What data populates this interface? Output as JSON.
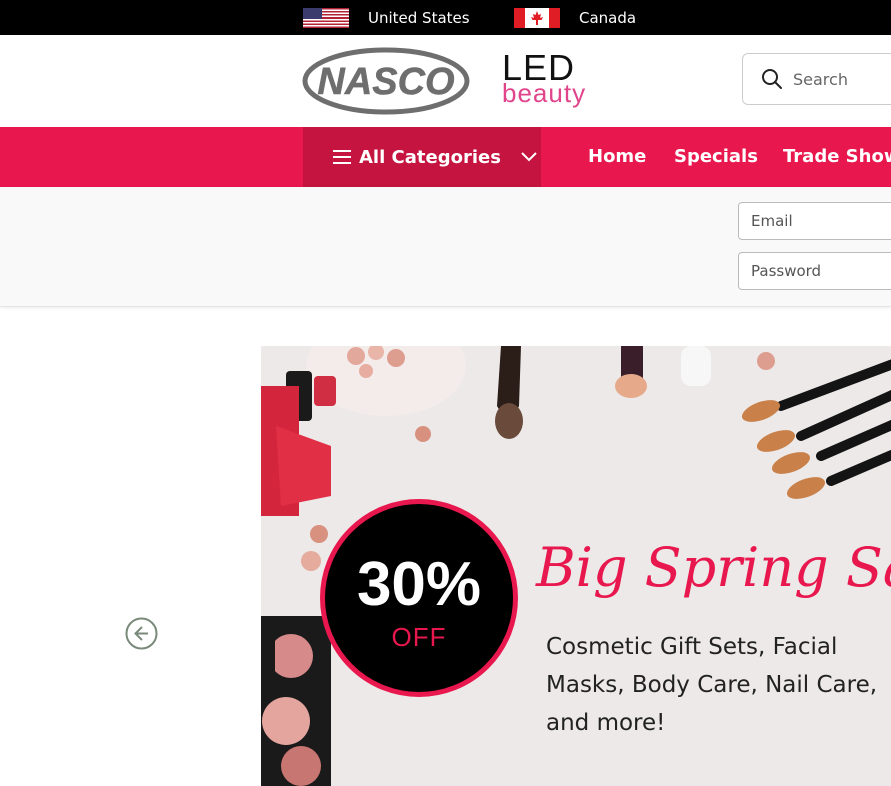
{
  "countries": [
    {
      "name": "United States",
      "flag": "us-flag-icon"
    },
    {
      "name": "Canada",
      "flag": "canada-flag-icon"
    }
  ],
  "header": {
    "logo_nasco": "NASCO",
    "logo_led": "LED",
    "logo_beauty": "beauty",
    "search_placeholder": "Search"
  },
  "nav": {
    "all_categories": "All Categories",
    "links": [
      "Home",
      "Specials",
      "Trade Show"
    ]
  },
  "login": {
    "email_placeholder": "Email",
    "password_placeholder": "Password"
  },
  "banner": {
    "discount": "30%",
    "off": "OFF",
    "title": "Big Spring Sale",
    "description": "Cosmetic Gift Sets, Facial Masks, Body Care, Nail Care, and more!"
  },
  "colors": {
    "accent": "#e8174e",
    "accent_dark": "#c5143f",
    "topbar": "#000000"
  }
}
